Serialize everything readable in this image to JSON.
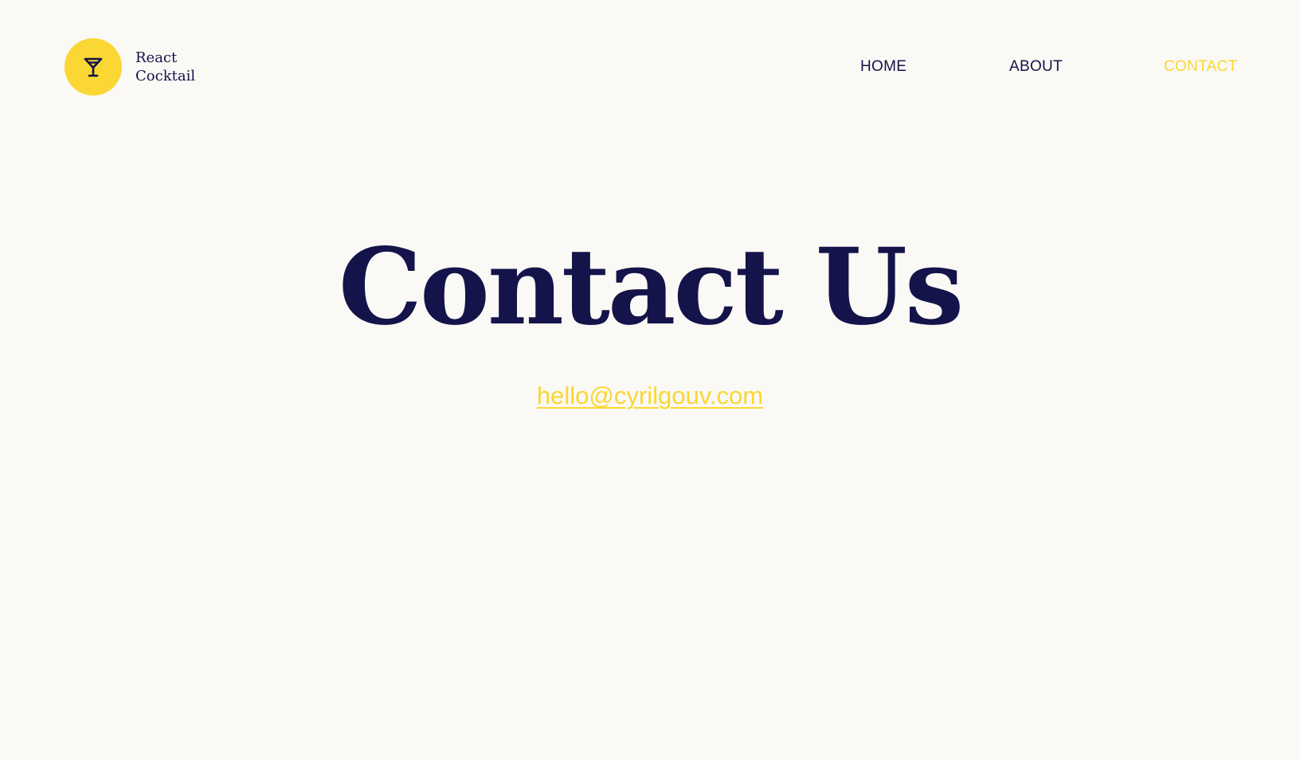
{
  "brand": {
    "line1": "React",
    "line2": "Cocktail",
    "icon": "cocktail-glass-icon",
    "accent_color": "#fad733"
  },
  "nav": {
    "items": [
      {
        "label": "HOME"
      },
      {
        "label": "ABOUT"
      },
      {
        "label": "CONTACT",
        "active": true
      }
    ],
    "text_color": "#14134a",
    "active_color": "#fad733"
  },
  "main": {
    "title": "Contact Us",
    "email": "hello@cyrilgouv.com"
  },
  "colors": {
    "background": "#faf9f5",
    "primary": "#14134a",
    "accent": "#fad733"
  }
}
